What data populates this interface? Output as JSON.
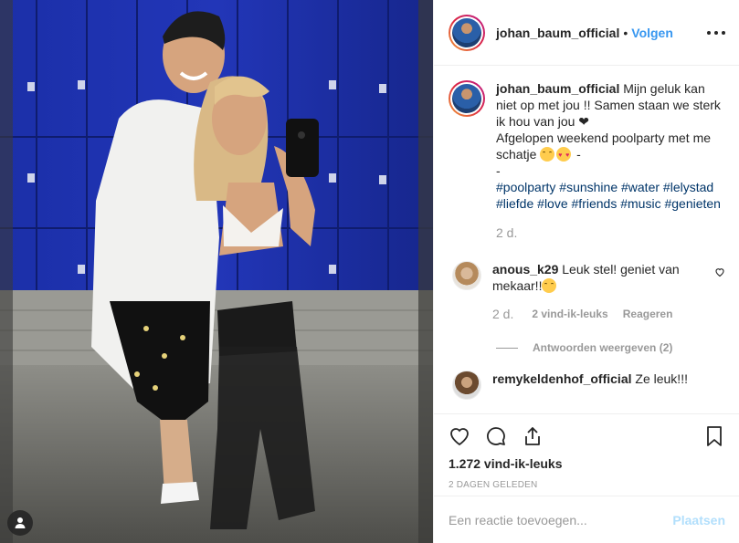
{
  "post": {
    "username": "johan_baum_official",
    "separator": "•",
    "follow_label": "Volgen",
    "more_icon": "more-horizontal-icon"
  },
  "caption": {
    "username": "johan_baum_official",
    "line1": "Mijn geluk kan niet op met jou !! Samen staan we sterk ik hou van jou ❤",
    "line2": "Afgelopen weekend poolparty met me schatje",
    "line2_suffix": "-",
    "line3": "-",
    "hashtags": [
      "#poolparty",
      "#sunshine",
      "#water",
      "#lelystad",
      "#liefde",
      "#love",
      "#friends",
      "#music",
      "#genieten"
    ],
    "time": "2 d."
  },
  "comments": [
    {
      "username": "anous_k29",
      "text": "Leuk stel! geniet van mekaar!!",
      "emoji": "hugging-face",
      "time": "2 d.",
      "likes": "2 vind-ik-leuks",
      "reply": "Reageren",
      "view_replies": "Antwoorden weergeven (2)"
    },
    {
      "username": "remykeldenhof_official",
      "text": "Ze leuk!!!"
    }
  ],
  "actions": {
    "like_icon": "heart-icon",
    "comment_icon": "comment-icon",
    "share_icon": "share-icon",
    "save_icon": "bookmark-icon",
    "likes_count": "1.272 vind-ik-leuks",
    "date": "2 DAGEN GELEDEN"
  },
  "add_comment": {
    "placeholder": "Een reactie toevoegen...",
    "post_label": "Plaatsen"
  },
  "colors": {
    "link": "#3897f0",
    "hashtag": "#003569",
    "muted": "#999999",
    "post_disabled": "#b2dffc",
    "locker_blue": "#1a2a9a"
  }
}
